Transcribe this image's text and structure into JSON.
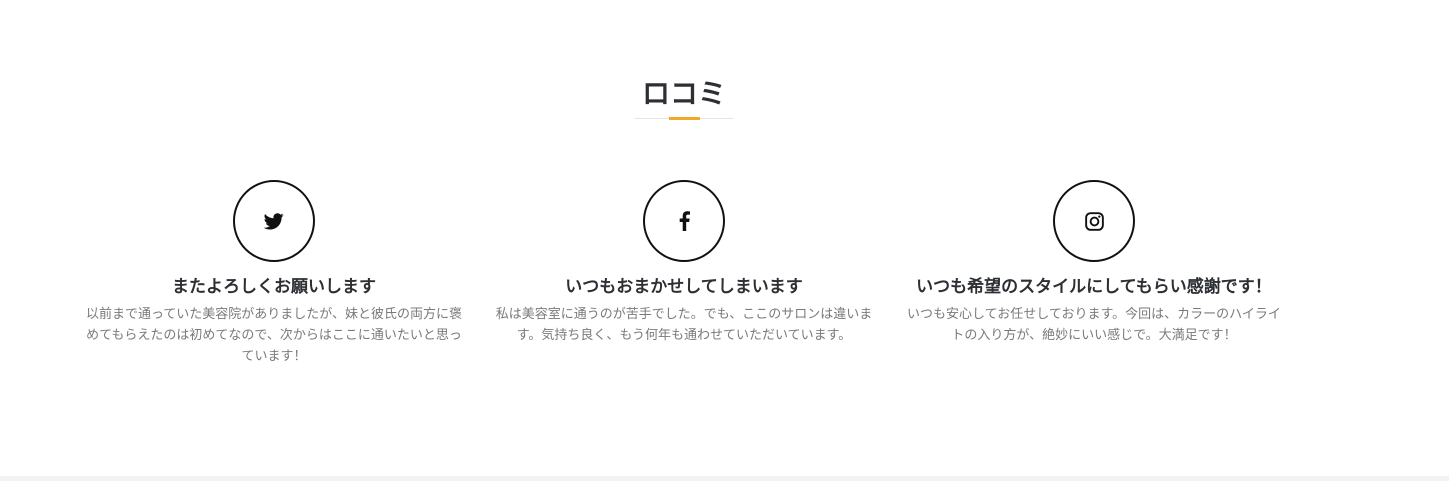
{
  "section": {
    "title": "ロコミ"
  },
  "colors": {
    "accent": "#f0a929",
    "heading": "#2c2f33",
    "body_text": "#7a7a7a",
    "icon_border": "#111111"
  },
  "reviews": [
    {
      "icon": "twitter-icon",
      "title": "またよろしくお願いします",
      "text": "以前まで通っていた美容院がありましたが、妹と彼氏の両方に褒めてもらえたのは初めてなので、次からはここに通いたいと思っています！"
    },
    {
      "icon": "facebook-icon",
      "title": "いつもおまかせしてしまいます",
      "text": "私は美容室に通うのが苦手でした。でも、ここのサロンは違います。気持ち良く、もう何年も通わせていただいています。"
    },
    {
      "icon": "instagram-icon",
      "title": "いつも希望のスタイルにしてもらい感謝です！",
      "text": "いつも安心してお任せしております。今回は、カラーのハイライトの入り方が、絶妙にいい感じで。大満足です！"
    }
  ]
}
